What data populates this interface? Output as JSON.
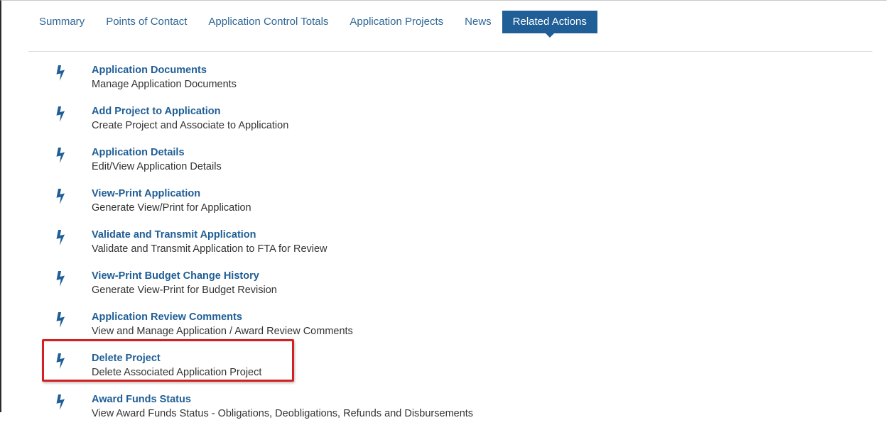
{
  "tabs": [
    {
      "label": "Summary",
      "active": false
    },
    {
      "label": "Points of Contact",
      "active": false
    },
    {
      "label": "Application Control Totals",
      "active": false
    },
    {
      "label": "Application Projects",
      "active": false
    },
    {
      "label": "News",
      "active": false
    },
    {
      "label": "Related Actions",
      "active": true
    }
  ],
  "actions": [
    {
      "title": "Application Documents",
      "description": "Manage Application Documents",
      "icon": "lightning-bolt-icon"
    },
    {
      "title": "Add Project to Application",
      "description": "Create Project and Associate to Application",
      "icon": "lightning-bolt-icon"
    },
    {
      "title": "Application Details",
      "description": "Edit/View Application Details",
      "icon": "lightning-bolt-icon"
    },
    {
      "title": "View-Print Application",
      "description": "Generate View/Print for Application",
      "icon": "lightning-bolt-icon"
    },
    {
      "title": "Validate and Transmit Application",
      "description": "Validate and Transmit Application to FTA for Review",
      "icon": "lightning-bolt-icon"
    },
    {
      "title": "View-Print Budget Change History",
      "description": "Generate View-Print for Budget Revision",
      "icon": "lightning-bolt-icon"
    },
    {
      "title": "Application Review Comments",
      "description": "View and Manage Application / Award Review Comments",
      "icon": "lightning-bolt-icon"
    },
    {
      "title": "Delete Project",
      "description": "Delete Associated Application Project",
      "icon": "lightning-bolt-icon",
      "highlighted": true
    },
    {
      "title": "Award Funds Status",
      "description": "View Award Funds Status - Obligations, Deobligations, Refunds and Disbursements",
      "icon": "lightning-bolt-icon"
    }
  ],
  "colors": {
    "accent": "#1f5e96",
    "link": "#2f6796",
    "highlight": "#d42020",
    "text": "#333333"
  }
}
